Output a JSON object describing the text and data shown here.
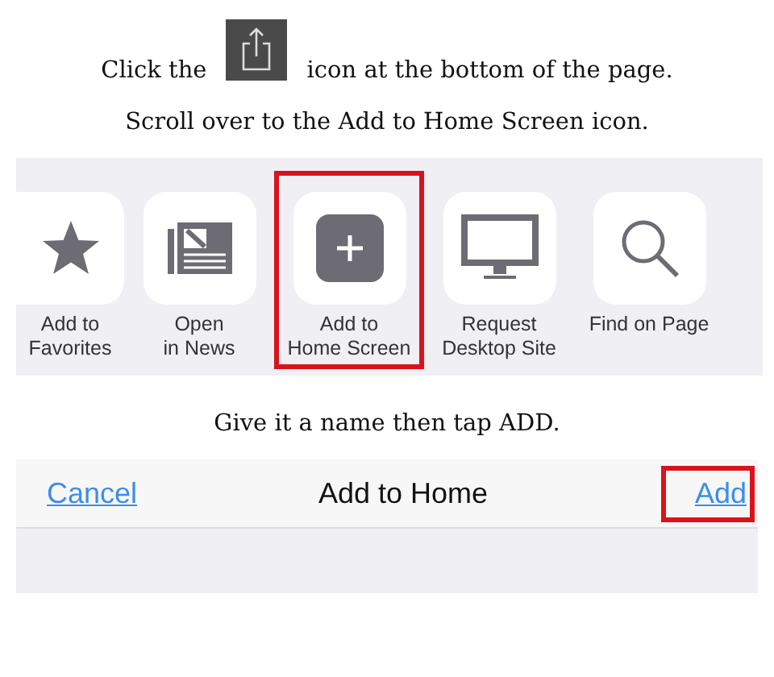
{
  "step_1": {
    "before_icon": "Click the",
    "after_icon": "icon at the bottom of the page."
  },
  "step_2": {
    "text": "Scroll over to the Add to Home Screen icon."
  },
  "share_sheet": {
    "actions": [
      {
        "kind": "star",
        "label": "Add to\nFavorites",
        "highlighted": false
      },
      {
        "kind": "news",
        "label": "Open\nin News",
        "highlighted": false
      },
      {
        "kind": "add",
        "label": "Add to\nHome Screen",
        "highlighted": true
      },
      {
        "kind": "desktop",
        "label": "Request\nDesktop Site",
        "highlighted": false
      },
      {
        "kind": "search",
        "label": "Find on Page",
        "highlighted": false
      }
    ]
  },
  "step_3": {
    "text": "Give it a name then tap ADD."
  },
  "nav_bar": {
    "cancel": "Cancel",
    "title": "Add to Home",
    "add": "Add",
    "add_highlighted": true
  }
}
